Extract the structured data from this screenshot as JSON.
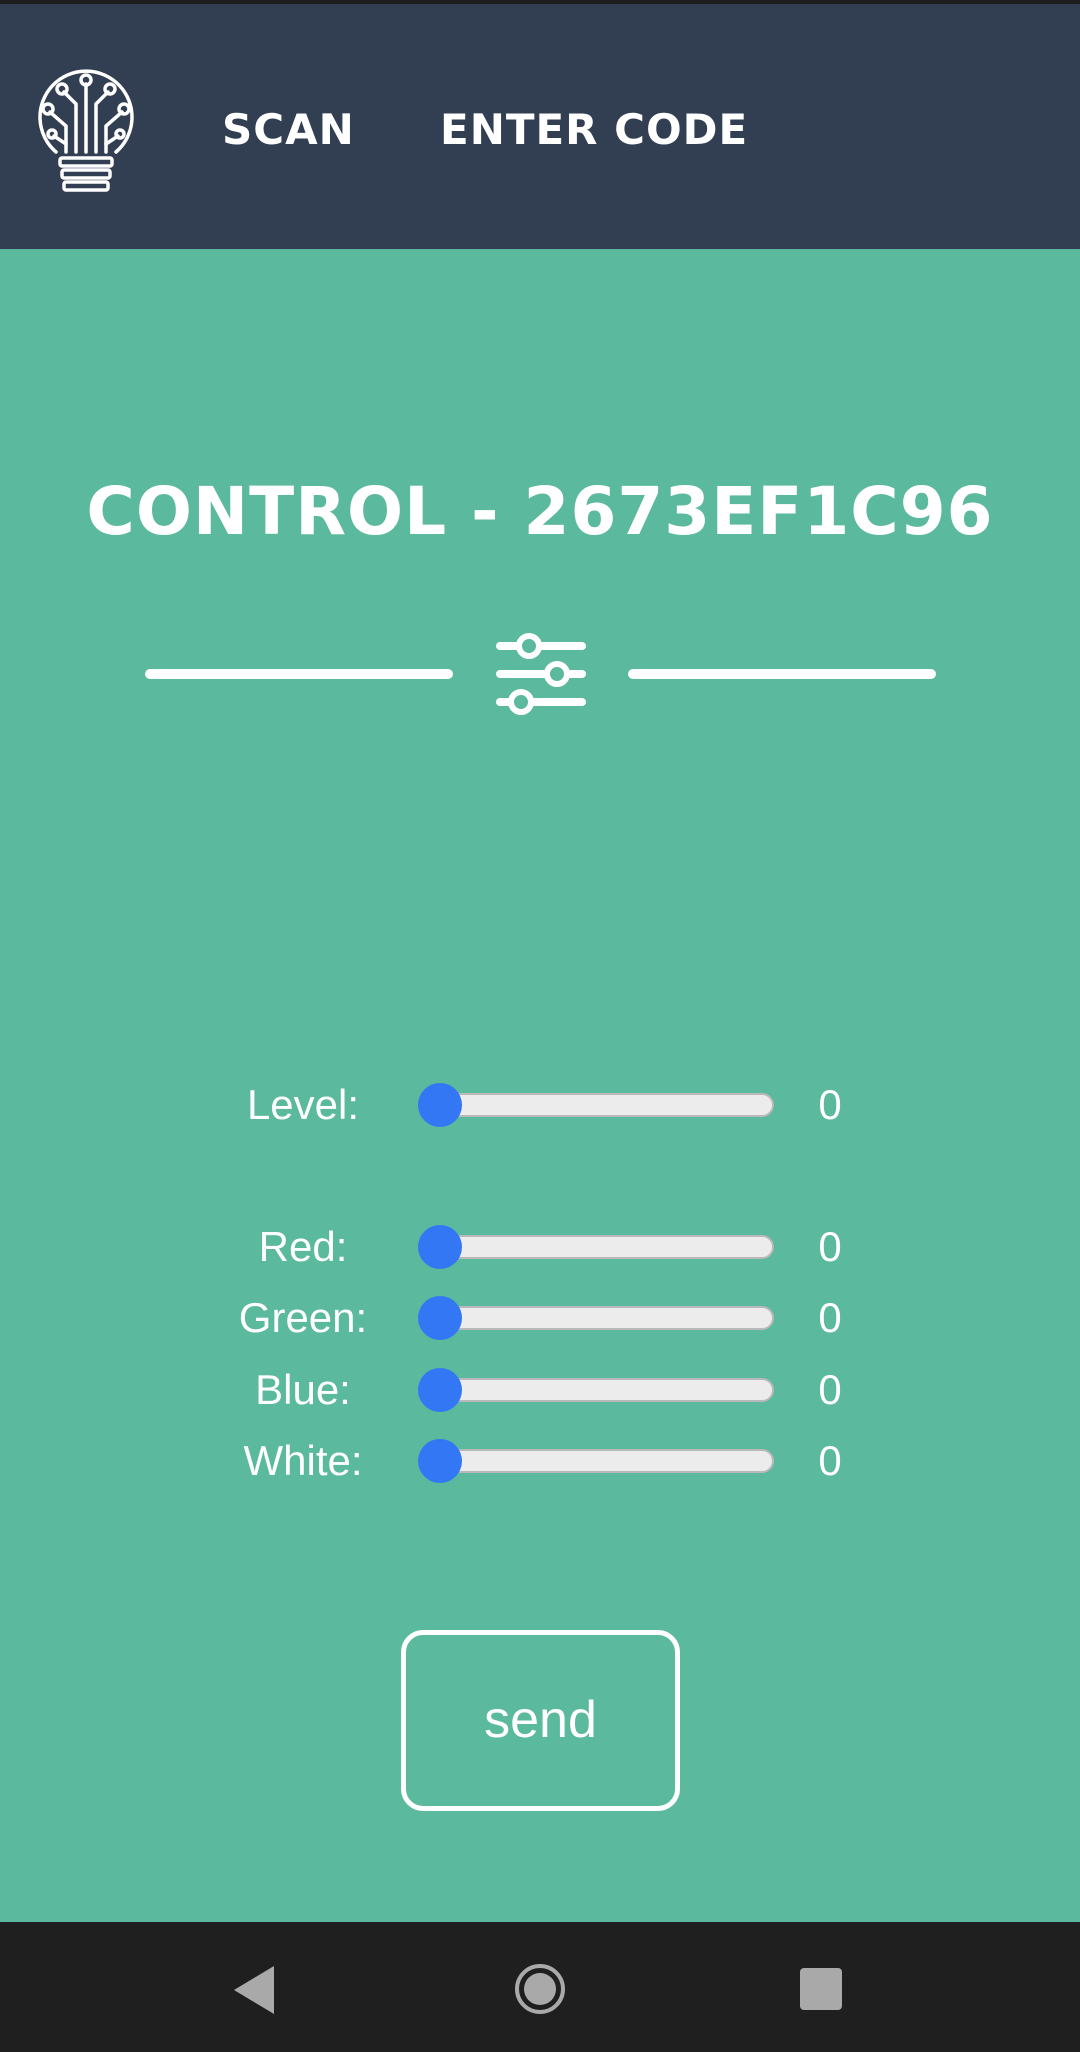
{
  "header": {
    "logo_icon": "circuit-lightbulb-icon",
    "nav": {
      "scan_label": "SCAN",
      "enter_code_label": "ENTER CODE"
    }
  },
  "main": {
    "title": "CONTROL - 2673EF1C96",
    "divider_icon": "sliders-icon",
    "controls": [
      {
        "label": "Level:",
        "value": "0"
      },
      {
        "label": "Red:",
        "value": "0"
      },
      {
        "label": "Green:",
        "value": "0"
      },
      {
        "label": "Blue:",
        "value": "0"
      },
      {
        "label": "White:",
        "value": "0"
      }
    ],
    "send_label": "send"
  },
  "system_nav": {
    "back_icon": "back-triangle-icon",
    "home_icon": "home-circle-icon",
    "recents_icon": "recents-square-icon"
  },
  "colors": {
    "header_bg": "#323e51",
    "content_bg": "#5bb99d",
    "slider_thumb": "#3377f4",
    "system_nav_bg": "#1f1f1f"
  }
}
